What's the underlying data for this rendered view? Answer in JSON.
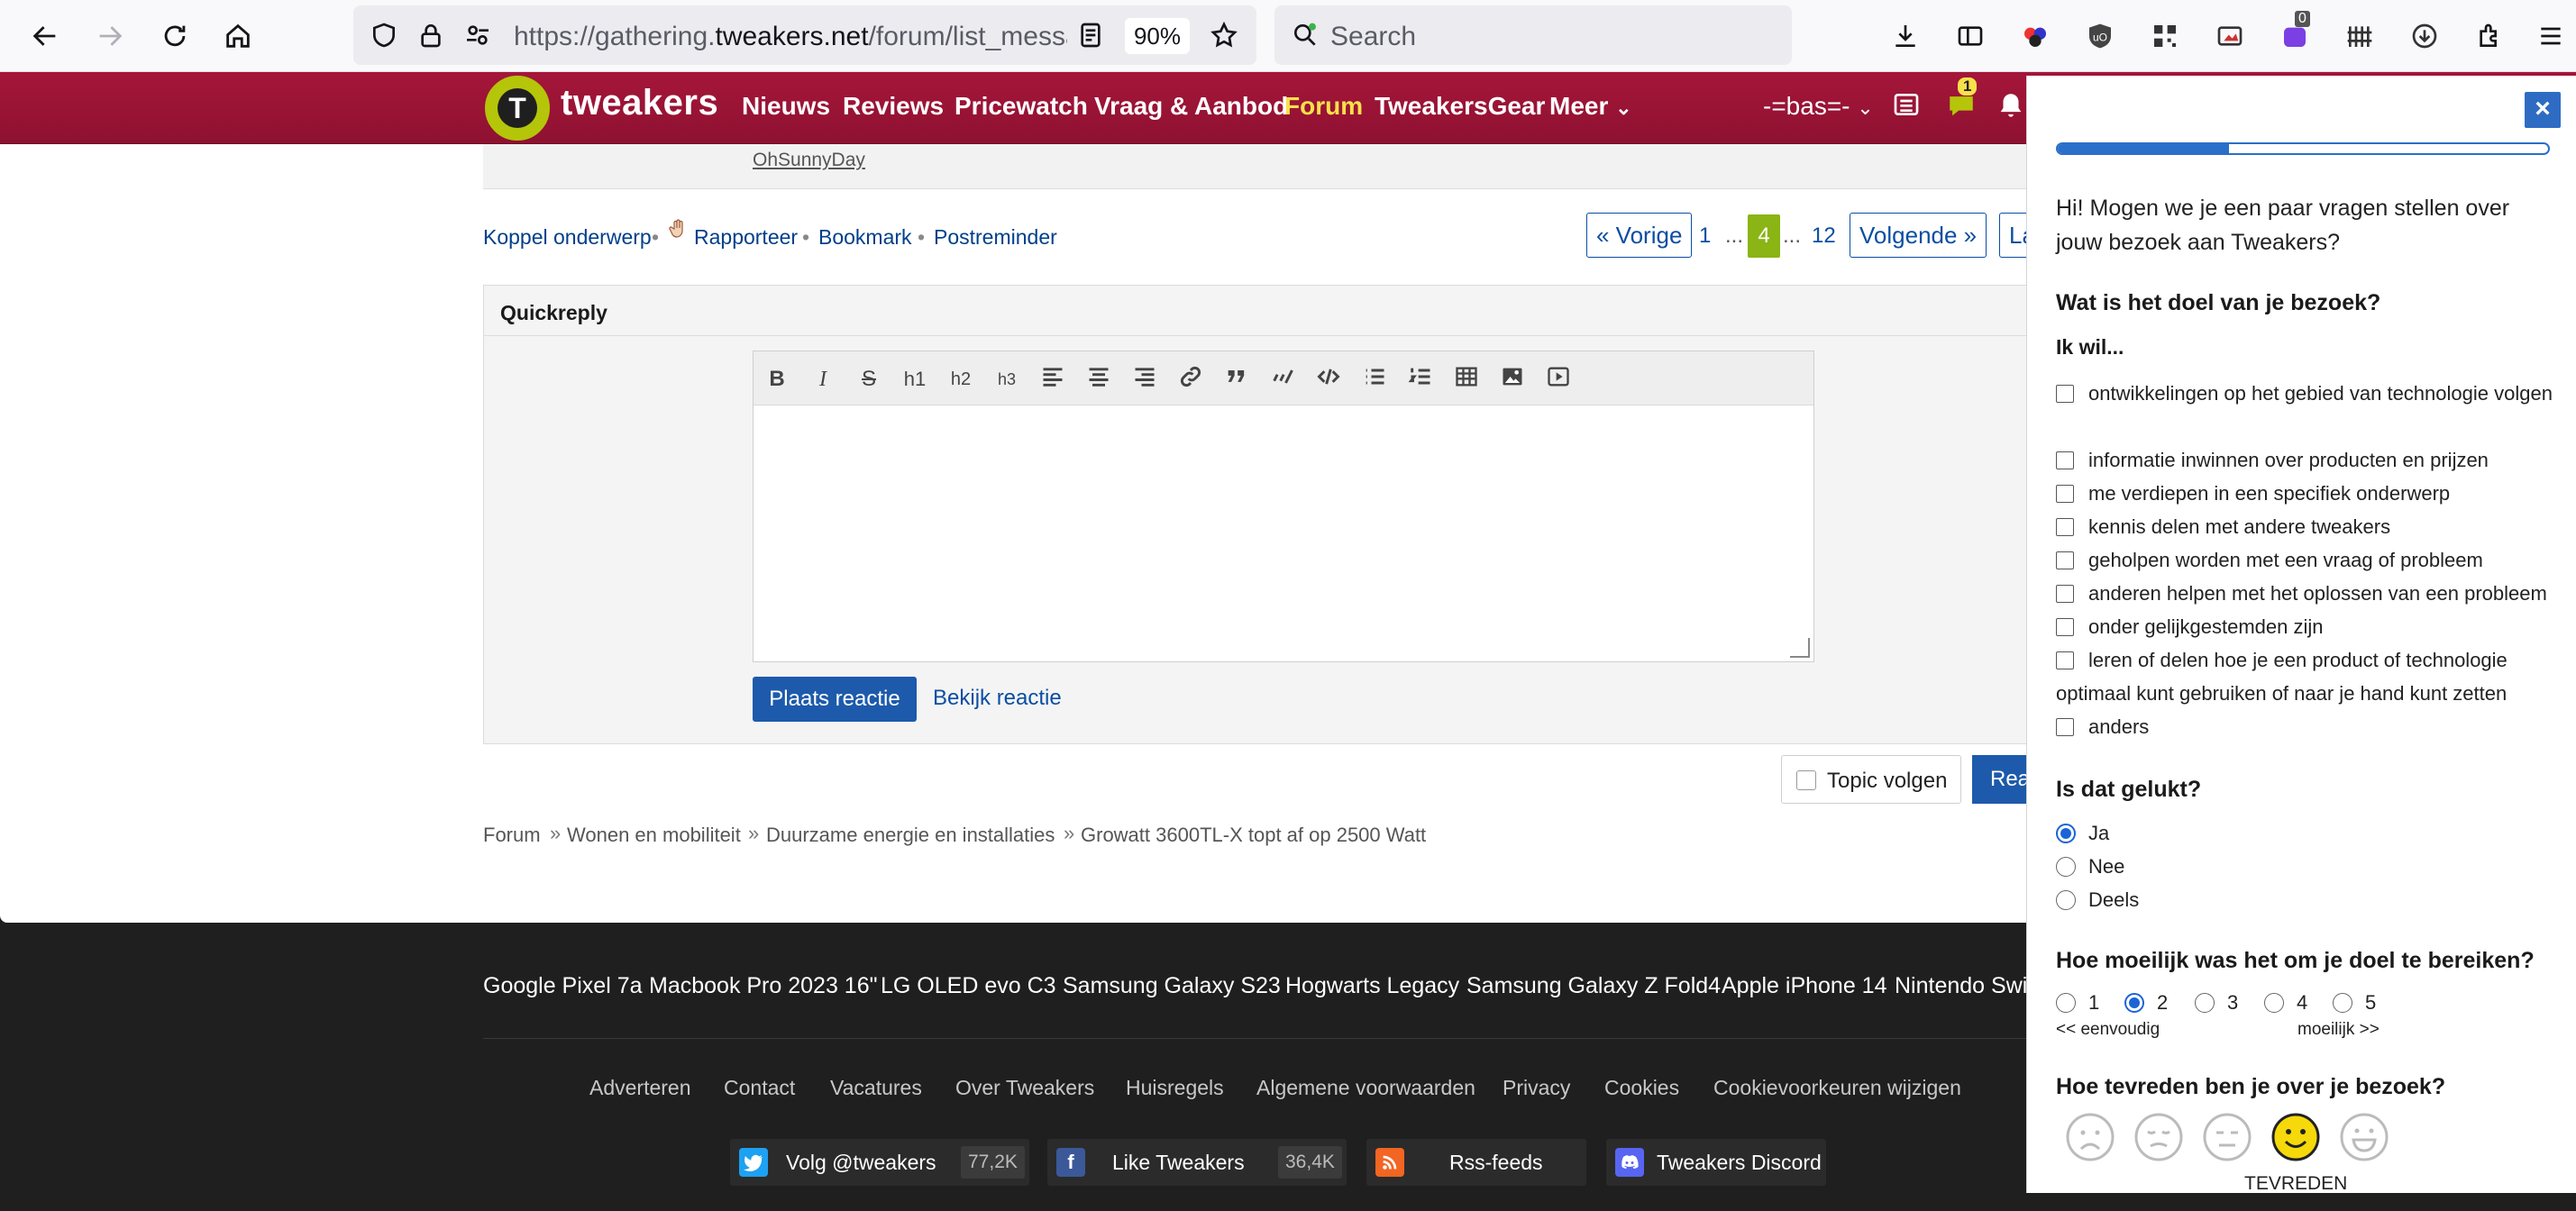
{
  "browser": {
    "url_prefix": "https://gathering.",
    "url_domain": "tweakers.net",
    "url_rest": "/forum/list_messa",
    "zoom": "90%",
    "search_placeholder": "Search",
    "badge_count": "0"
  },
  "site": {
    "logo_text": "tweakers",
    "logo_letter": "T",
    "nav": [
      "Nieuws",
      "Reviews",
      "Pricewatch",
      "Vraag & Aanbod",
      "Forum",
      "TweakersGear",
      "Meer"
    ],
    "active_nav": "Forum",
    "user": "-=bas=-",
    "notif_count": "1"
  },
  "post": {
    "author_signature": "OhSunnyDay"
  },
  "actions": {
    "koppel": "Koppel onderwerp",
    "rapporteer": "Rapporteer",
    "bookmark": "Bookmark",
    "postreminder": "Postreminder"
  },
  "pagination": {
    "prev": "« Vorige",
    "first": "1",
    "dots1": "...",
    "current": "4",
    "dots2": "...",
    "last": "12",
    "next": "Volgende »",
    "last_btn": "La"
  },
  "quickreply": {
    "title": "Quickreply",
    "toolbar": [
      "B",
      "I",
      "S",
      "h1",
      "h2",
      "h3",
      "align-left",
      "align-center",
      "align-right",
      "link",
      "quote",
      "spoiler",
      "code",
      "bullet-list",
      "numbered-list",
      "table",
      "image",
      "video"
    ],
    "submit": "Plaats reactie",
    "preview": "Bekijk reactie"
  },
  "topic": {
    "follow": "Topic volgen",
    "react": "Rea"
  },
  "breadcrumb": [
    "Forum",
    "Wonen en mobiliteit",
    "Duurzame energie en installaties",
    "Growatt 3600TL-X topt af op 2500 Watt"
  ],
  "footer": {
    "trending": [
      "Google Pixel 7a",
      "Macbook Pro 2023 16\"",
      "LG OLED evo C3",
      "Samsung Galaxy S23",
      "Hogwarts Legacy",
      "Samsung Galaxy Z Fold4",
      "Apple iPhone 14",
      "Nintendo Swit"
    ],
    "links": [
      "Adverteren",
      "Contact",
      "Vacatures",
      "Over Tweakers",
      "Huisregels",
      "Algemene voorwaarden",
      "Privacy",
      "Cookies",
      "Cookievoorkeuren wijzigen"
    ],
    "social": {
      "twitter_label": "Volg @tweakers",
      "twitter_count": "77,2K",
      "facebook_label": "Like Tweakers",
      "facebook_count": "36,4K",
      "rss_label": "Rss-feeds",
      "discord_label": "Tweakers Discord"
    }
  },
  "survey": {
    "close": "×",
    "progress": 0.35,
    "intro": "Hi! Mogen we je een paar vragen stellen over jouw bezoek aan Tweakers?",
    "q1": "Wat is het doel van je bezoek?",
    "q1_sub": "Ik wil...",
    "q1_options": [
      "ontwikkelingen op het gebied van technologie volgen",
      "informatie inwinnen over producten en prijzen",
      "me verdiepen in een specifiek onderwerp",
      "kennis delen met andere tweakers",
      "geholpen worden met een vraag of probleem",
      "anderen helpen met het oplossen van een probleem",
      "onder gelijkgestemden zijn",
      "leren of delen hoe je een product of technologie optimaal kunt gebruiken of naar je hand kunt zetten",
      "anders"
    ],
    "q2": "Is dat gelukt?",
    "q2_options": [
      "Ja",
      "Nee",
      "Deels"
    ],
    "q2_selected": "Ja",
    "q3": "Hoe moeilijk was het om je doel te bereiken?",
    "q3_options": [
      "1",
      "2",
      "3",
      "4",
      "5"
    ],
    "q3_selected": "2",
    "q3_low": "<< eenvoudig",
    "q3_high": "moeilijk >>",
    "q4": "Hoe tevreden ben je over je bezoek?",
    "q4_selected_label": "TEVREDEN",
    "q4_selected": 4
  },
  "colors": {
    "header": "#9b1436",
    "accent_green": "#8bb415",
    "link_blue": "#0b4ea2",
    "survey_blue": "#2a6fc9"
  }
}
